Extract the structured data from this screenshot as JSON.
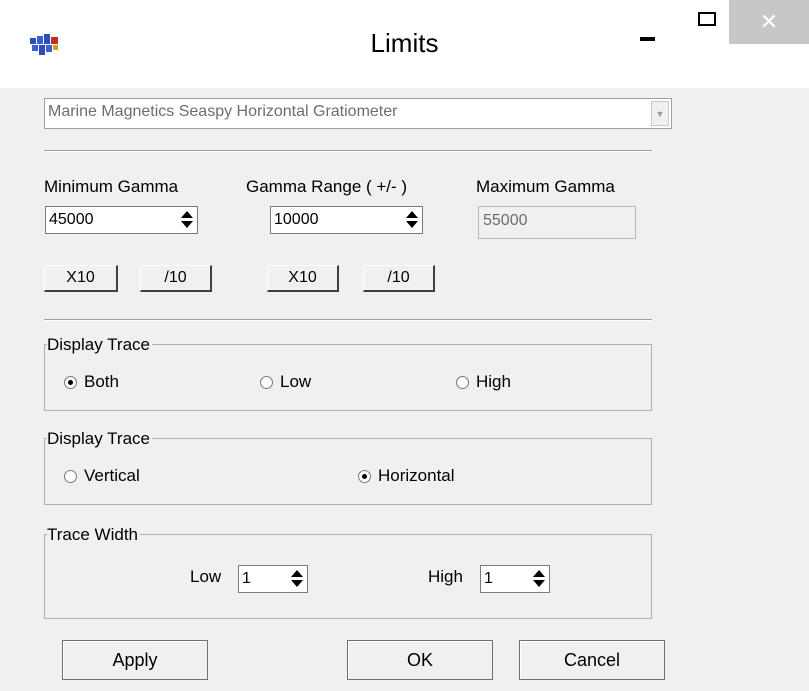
{
  "window": {
    "title": "Limits",
    "app_icon": "app-logo-icon",
    "controls": {
      "minimize": "minimize-icon",
      "maximize": "maximize-icon",
      "close": "✕"
    }
  },
  "sensor_select": {
    "value": "Marine Magnetics Seaspy Horizontal Gratiometer"
  },
  "gamma": {
    "minimum": {
      "label": "Minimum Gamma",
      "value": "45000",
      "x10_label": "X10",
      "div10_label": "/10"
    },
    "range": {
      "label": "Gamma Range ( +/- )",
      "value": "10000",
      "x10_label": "X10",
      "div10_label": "/10"
    },
    "maximum": {
      "label": "Maximum Gamma",
      "value": "55000"
    }
  },
  "display_trace_level": {
    "title": "Display Trace",
    "options": [
      {
        "label": "Both",
        "checked": true
      },
      {
        "label": "Low",
        "checked": false
      },
      {
        "label": "High",
        "checked": false
      }
    ]
  },
  "display_trace_orientation": {
    "title": "Display Trace",
    "options": [
      {
        "label": "Vertical",
        "checked": false
      },
      {
        "label": "Horizontal",
        "checked": true
      }
    ]
  },
  "trace_width": {
    "title": "Trace Width",
    "low": {
      "label": "Low",
      "value": "1"
    },
    "high": {
      "label": "High",
      "value": "1"
    }
  },
  "buttons": {
    "apply": "Apply",
    "ok": "OK",
    "cancel": "Cancel"
  },
  "colors": {
    "dialog_bg": "#f0f0f0",
    "titlebar_bg": "#ffffff",
    "close_button_bg": "#c7c7c7",
    "disabled_text": "#6d6d6d"
  }
}
